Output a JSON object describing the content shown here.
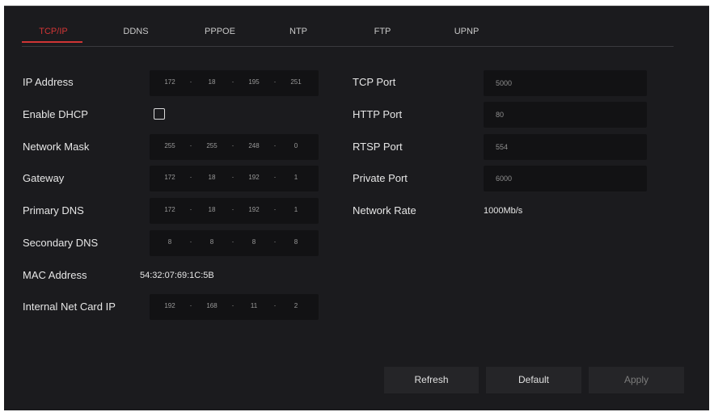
{
  "tabs": [
    {
      "label": "TCP/IP",
      "active": true
    },
    {
      "label": "DDNS",
      "active": false
    },
    {
      "label": "PPPOE",
      "active": false
    },
    {
      "label": "NTP",
      "active": false
    },
    {
      "label": "FTP",
      "active": false
    },
    {
      "label": "UPNP",
      "active": false
    }
  ],
  "left": {
    "ip_address": {
      "label": "IP Address",
      "octets": [
        "172",
        "18",
        "195",
        "251"
      ]
    },
    "enable_dhcp": {
      "label": "Enable DHCP",
      "checked": false
    },
    "network_mask": {
      "label": "Network Mask",
      "octets": [
        "255",
        "255",
        "248",
        "0"
      ]
    },
    "gateway": {
      "label": "Gateway",
      "octets": [
        "172",
        "18",
        "192",
        "1"
      ]
    },
    "primary_dns": {
      "label": "Primary DNS",
      "octets": [
        "172",
        "18",
        "192",
        "1"
      ]
    },
    "secondary_dns": {
      "label": "Secondary DNS",
      "octets": [
        "8",
        "8",
        "8",
        "8"
      ]
    },
    "mac_address": {
      "label": "MAC Address",
      "value": "54:32:07:69:1C:5B"
    },
    "internal_net_card_ip": {
      "label": "Internal Net Card IP",
      "octets": [
        "192",
        "168",
        "11",
        "2"
      ]
    }
  },
  "right": {
    "tcp_port": {
      "label": "TCP Port",
      "value": "5000"
    },
    "http_port": {
      "label": "HTTP Port",
      "value": "80"
    },
    "rtsp_port": {
      "label": "RTSP Port",
      "value": "554"
    },
    "private_port": {
      "label": "Private Port",
      "value": "6000"
    },
    "network_rate": {
      "label": "Network Rate",
      "value": "1000Mb/s"
    }
  },
  "buttons": {
    "refresh": "Refresh",
    "default": "Default",
    "apply": "Apply"
  },
  "ip_separator": "·",
  "colors": {
    "background": "#1b1b1e",
    "field": "#121214",
    "accent": "#d03535",
    "button": "#252528"
  }
}
